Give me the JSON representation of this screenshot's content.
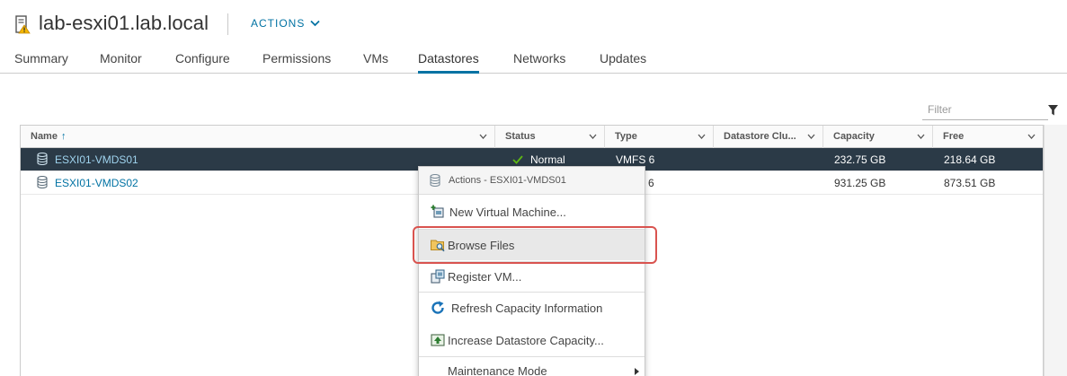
{
  "header": {
    "host_name": "lab-esxi01.lab.local",
    "actions_label": "ACTIONS",
    "host_icon": "host-warning-icon"
  },
  "tabs": [
    {
      "label": "Summary",
      "active": false
    },
    {
      "label": "Monitor",
      "active": false
    },
    {
      "label": "Configure",
      "active": false
    },
    {
      "label": "Permissions",
      "active": false
    },
    {
      "label": "VMs",
      "active": false
    },
    {
      "label": "Datastores",
      "active": true
    },
    {
      "label": "Networks",
      "active": false
    },
    {
      "label": "Updates",
      "active": false
    }
  ],
  "filter": {
    "placeholder": "Filter",
    "icon": "funnel-icon"
  },
  "grid": {
    "columns": [
      "Name",
      "Status",
      "Type",
      "Datastore Clu...",
      "Capacity",
      "Free"
    ],
    "sort_column": "Name",
    "sort_direction": "ascending",
    "rows": [
      {
        "name": "ESXI01-VMDS01",
        "status": "Normal",
        "type": "VMFS 6",
        "cluster": "",
        "capacity": "232.75 GB",
        "free": "218.64 GB",
        "selected": true
      },
      {
        "name": "ESXI01-VMDS02",
        "status": "",
        "type": "6",
        "cluster": "",
        "capacity": "931.25 GB",
        "free": "873.51 GB",
        "selected": false
      }
    ]
  },
  "context_menu": {
    "title": "Actions - ESXI01-VMDS01",
    "items": [
      {
        "label": "New Virtual Machine...",
        "icon": "new-vm-icon"
      },
      {
        "label": "Browse Files",
        "icon": "browse-files-icon",
        "highlighted": true
      },
      {
        "label": "Register VM...",
        "icon": "register-vm-icon"
      },
      {
        "label": "Refresh Capacity Information",
        "icon": "refresh-icon"
      },
      {
        "label": "Increase Datastore Capacity...",
        "icon": "increase-capacity-icon"
      },
      {
        "label": "Maintenance Mode",
        "icon": "",
        "submenu": true
      }
    ]
  },
  "colors": {
    "accent": "#0072a3",
    "selected_row": "#2b3a47",
    "status_ok": "#5eb715",
    "highlight_outline": "#d9534f"
  }
}
